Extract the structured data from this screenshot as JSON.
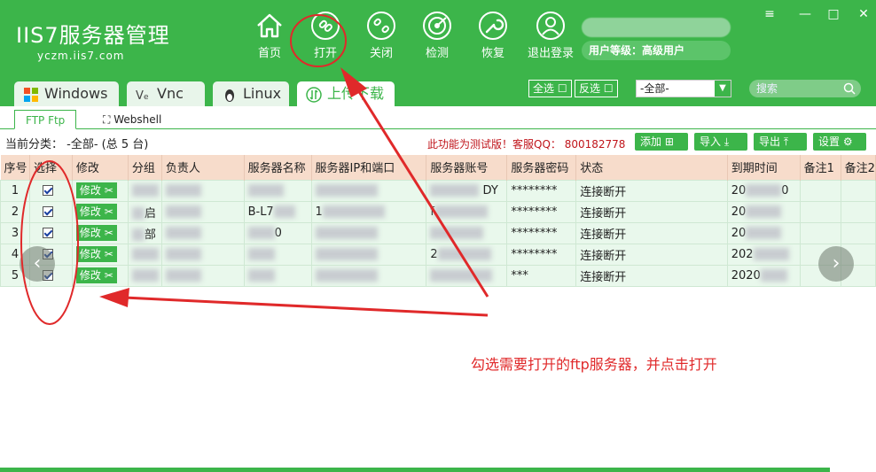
{
  "header": {
    "logo_title": "IIS7服务器管理",
    "logo_sub": "yczm.iis7.com",
    "nav": [
      {
        "label": "首页",
        "icon": "home-icon"
      },
      {
        "label": "打开",
        "icon": "link-icon"
      },
      {
        "label": "关闭",
        "icon": "unlink-icon"
      },
      {
        "label": "检测",
        "icon": "radar-icon"
      },
      {
        "label": "恢复",
        "icon": "wrench-icon"
      },
      {
        "label": "退出登录",
        "icon": "user-icon"
      }
    ],
    "user_level": "用户等级：高级用户",
    "window_controls": [
      "≡",
      "—",
      "□",
      "✕"
    ]
  },
  "tabs": [
    {
      "label": "Windows",
      "icon": "windows-icon"
    },
    {
      "label": "Vnc",
      "icon": "vnc-icon"
    },
    {
      "label": "Linux",
      "icon": "linux-icon"
    },
    {
      "label": "上传下载",
      "icon": "transfer-icon"
    }
  ],
  "toolbar": {
    "select_all": "全选",
    "invert_select": "反选",
    "category_value": "-全部-",
    "search_placeholder": "搜索"
  },
  "subtabs": [
    {
      "label": "FTP  Ftp"
    },
    {
      "label": "Webshell"
    }
  ],
  "info": {
    "current_category": "当前分类：  -全部- (总 5 台)",
    "notice": "此功能为测试版！客服QQ：  800182778",
    "add": "添加",
    "import": "导入",
    "export": "导出",
    "settings": "设置"
  },
  "table": {
    "headers": [
      "序号",
      "选择",
      "修改",
      "分组",
      "负责人",
      "服务器名称",
      "服务器IP和端口",
      "服务器账号",
      "服务器密码",
      "状态",
      "到期时间",
      "备注1",
      "备注2"
    ],
    "edit_label": "修改",
    "rows": [
      {
        "no": "1",
        "account_tail": "DY",
        "password": "********",
        "status": "连接断开",
        "expire_prefix": "20",
        "expire_tail": "0"
      },
      {
        "no": "2",
        "group_tail": "启",
        "name_prefix": "B-L7",
        "ip_prefix": "1",
        "account_prefix": "f",
        "password": "********",
        "status": "连接断开",
        "expire_prefix": "20"
      },
      {
        "no": "3",
        "group_tail": "部",
        "name_tail": "0",
        "password": "********",
        "status": "连接断开",
        "expire_prefix": "20"
      },
      {
        "no": "4",
        "account_prefix": "2",
        "password": "********",
        "status": "连接断开",
        "expire_prefix": "202"
      },
      {
        "no": "5",
        "password": "***",
        "status": "连接断开",
        "expire_prefix": "2020"
      }
    ]
  },
  "annotation": {
    "text": "勾选需要打开的ftp服务器，并点击打开",
    "color": "#e0292a"
  },
  "colors": {
    "brand": "#3cb54a",
    "header_row": "#f7dccb",
    "row_bg": "#e9f8ec"
  }
}
